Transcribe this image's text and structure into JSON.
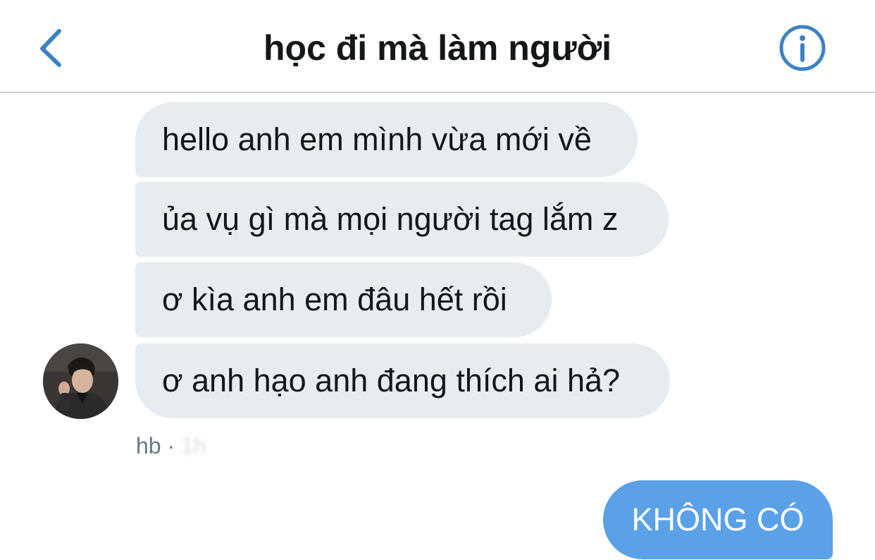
{
  "header": {
    "title": "học đi mà làm người",
    "back_icon": "chevron-left-icon",
    "info_icon": "info-circle-icon",
    "accent_color": "#3b82c4"
  },
  "messages": {
    "received": [
      {
        "text": "hello anh em mình vừa mới về"
      },
      {
        "text": "ủa vụ gì mà mọi người tag lắm z"
      },
      {
        "text": "ơ kìa anh em đâu hết rồi"
      },
      {
        "text": "ơ anh hạo anh đang thích ai hả?"
      }
    ],
    "received_meta": {
      "sender": "hb",
      "separator": "·",
      "time_blurred": "1h"
    },
    "sent": [
      {
        "text": "KHÔNG CÓ"
      }
    ]
  },
  "colors": {
    "received_bubble": "#e6ecf0",
    "sent_bubble": "#5aa1e8",
    "meta_text": "#657786"
  }
}
